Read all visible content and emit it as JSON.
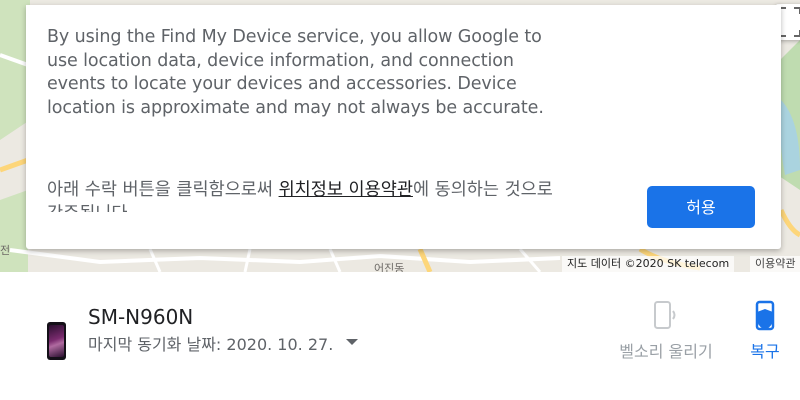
{
  "map": {
    "road_label": "어진동",
    "side_labels": [
      "전"
    ],
    "attribution": "지도 데이터 ©2020 SK telecom",
    "terms_link": "이용약관"
  },
  "consent": {
    "paragraph": "By using the Find My Device service, you allow Google to use location data, device information, and connection events to locate your devices and accessories. Device location is approximate and may not always be accurate.",
    "korean_prefix": "아래 수락 버튼을 클릭함으로써 ",
    "korean_link": "위치정보 이용약관",
    "korean_suffix": "에 동의하는 것으로 간주됩니다.",
    "allow_button": "허용"
  },
  "device": {
    "name": "SM-N960N",
    "last_sync": "마지막 동기화 날짜: 2020. 10. 27.",
    "thumbnail_icon": "phone-thumbnail",
    "dropdown_icon": "caret-down-icon"
  },
  "actions": {
    "ring_label": "벨소리 울리기",
    "ring_icon": "ring-phone-icon",
    "secure_label": "복구",
    "secure_icon": "secure-device-icon"
  },
  "colors": {
    "accent": "#1a73e8",
    "text_secondary": "#5f6368",
    "disabled": "#9aa0a6"
  }
}
